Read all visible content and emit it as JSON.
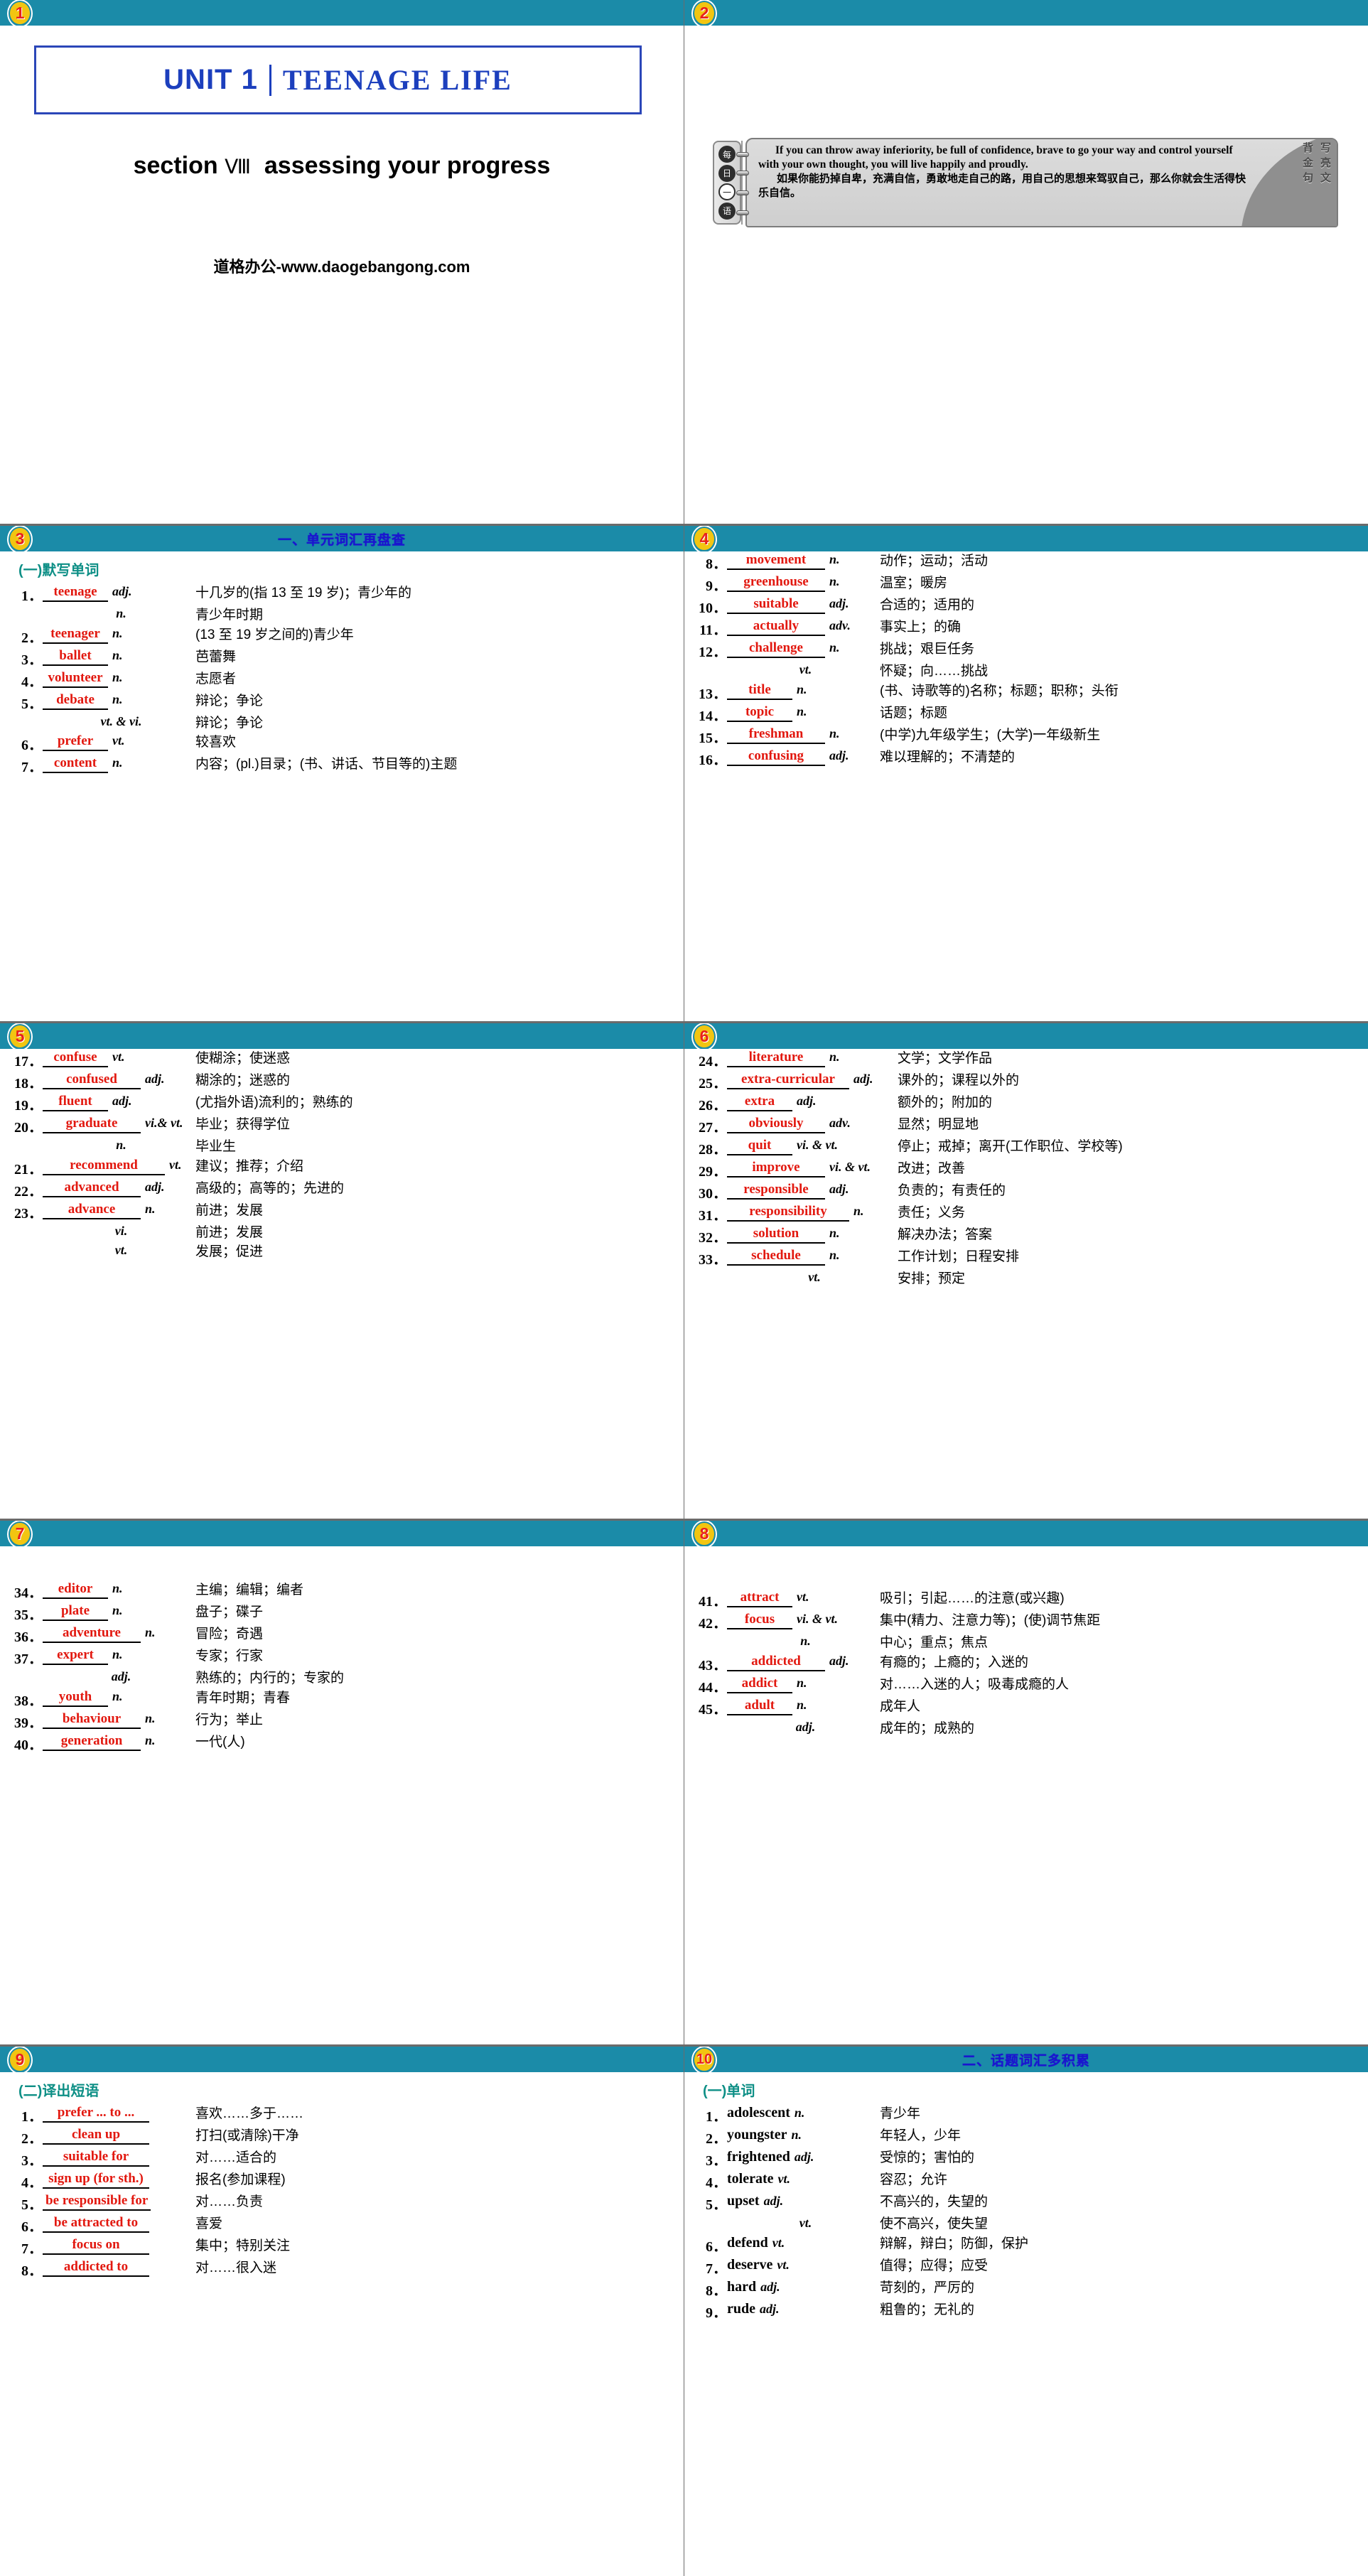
{
  "slides": [
    {
      "badge": "1",
      "title": "",
      "unit_label": "UNIT 1",
      "unit_name": "TEENAGE LIFE",
      "section_label": "section",
      "section_numeral": "Ⅷ",
      "section_name": "assessing your progress",
      "footer": "道格办公-www.daogebangong.com"
    },
    {
      "badge": "2",
      "title": "",
      "left_tab": [
        "每",
        "日",
        "一",
        "语"
      ],
      "quote_en": "If you can throw away inferiority, be full of confidence, brave to go your way and control yourself with your own thought, you will live happily and proudly.",
      "quote_zh": "如果你能扔掉自卑，充满自信，勇敢地走自己的路，用自己的思想来驾驭自己，那么你就会生活得快乐自信。",
      "right_tab_col1": "写亮文",
      "right_tab_col2": "背金句"
    },
    {
      "badge": "3",
      "title": "一、单元词汇再盘查",
      "subhead": "(一)默写单词",
      "rows": [
        {
          "num": "1．",
          "word": "teenage",
          "pos": "adj.",
          "def": "十几岁的(指 13 至 19 岁)；青少年的"
        },
        {
          "num": "",
          "word": "",
          "pos": "n.",
          "def": "青少年时期"
        },
        {
          "num": "2．",
          "word": "teenager",
          "pos": "n.",
          "def": "(13 至 19 岁之间的)青少年"
        },
        {
          "num": "3．",
          "word": "ballet",
          "pos": "n.",
          "def": "芭蕾舞"
        },
        {
          "num": "4．",
          "word": "volunteer",
          "pos": "n.",
          "def": "志愿者"
        },
        {
          "num": "5．",
          "word": "debate",
          "pos": "n.",
          "def": "辩论；争论"
        },
        {
          "num": "",
          "word": "",
          "pos": "vt. & vi.",
          "def": "辩论；争论"
        },
        {
          "num": "6．",
          "word": "prefer",
          "pos": "vt.",
          "def": "较喜欢"
        },
        {
          "num": "7．",
          "word": "content",
          "pos": "n.",
          "def": "内容；(pl.)目录；(书、讲话、节目等的)主题"
        }
      ]
    },
    {
      "badge": "4",
      "title": "",
      "rows": [
        {
          "num": "8．",
          "word": "movement",
          "pos": "n.",
          "def": "动作；运动；活动"
        },
        {
          "num": "9．",
          "word": "greenhouse",
          "pos": "n.",
          "def": "温室；暖房"
        },
        {
          "num": "10．",
          "word": "suitable",
          "pos": "adj.",
          "def": "合适的；适用的"
        },
        {
          "num": "11．",
          "word": "actually",
          "pos": "adv.",
          "def": "事实上；的确"
        },
        {
          "num": "12．",
          "word": "challenge",
          "pos": "n.",
          "def": "挑战；艰巨任务"
        },
        {
          "num": "",
          "word": "",
          "pos": "vt.",
          "def": "怀疑；向……挑战"
        },
        {
          "num": "13．",
          "word": "title",
          "pos": "n.",
          "def": "(书、诗歌等的)名称；标题；职称；头衔"
        },
        {
          "num": "14．",
          "word": "topic",
          "pos": "n.",
          "def": "话题；标题"
        },
        {
          "num": "15．",
          "word": "freshman",
          "pos": "n.",
          "def": "(中学)九年级学生；(大学)一年级新生"
        },
        {
          "num": "16．",
          "word": "confusing",
          "pos": "adj.",
          "def": "难以理解的；不清楚的"
        }
      ]
    },
    {
      "badge": "5",
      "title": "",
      "rows": [
        {
          "num": "17．",
          "word": "confuse",
          "pos": "vt.",
          "def": "使糊涂；使迷惑"
        },
        {
          "num": "18．",
          "word": "confused",
          "pos": "adj.",
          "def": "糊涂的；迷惑的"
        },
        {
          "num": "19．",
          "word": "fluent",
          "pos": "adj.",
          "def": "(尤指外语)流利的；熟练的"
        },
        {
          "num": "20．",
          "word": "graduate",
          "pos": "vi.& vt.",
          "def": "毕业；获得学位"
        },
        {
          "num": "",
          "word": "",
          "pos": "n.",
          "def": "毕业生"
        },
        {
          "num": "21．",
          "word": "recommend",
          "pos": "vt.",
          "def": "建议；推荐；介绍"
        },
        {
          "num": "22．",
          "word": "advanced",
          "pos": "adj.",
          "def": "高级的；高等的；先进的"
        },
        {
          "num": "23．",
          "word": "advance",
          "pos": "n.",
          "def": "前进；发展"
        },
        {
          "num": "",
          "word": "",
          "pos": "vi.",
          "def": "前进；发展"
        },
        {
          "num": "",
          "word": "",
          "pos": "vt.",
          "def": "发展；促进"
        }
      ]
    },
    {
      "badge": "6",
      "title": "",
      "rows": [
        {
          "num": "24．",
          "word": "literature",
          "pos": "n.",
          "def": "文学；文学作品"
        },
        {
          "num": "25．",
          "word": "extra-curricular",
          "pos": "adj.",
          "def": "课外的；课程以外的"
        },
        {
          "num": "26．",
          "word": "extra",
          "pos": "adj.",
          "def": "额外的；附加的"
        },
        {
          "num": "27．",
          "word": "obviously",
          "pos": "adv.",
          "def": "显然；明显地"
        },
        {
          "num": "28．",
          "word": "quit",
          "pos": "vi. & vt.",
          "def": "停止；戒掉；离开(工作职位、学校等)"
        },
        {
          "num": "29．",
          "word": "improve",
          "pos": "vi. & vt.",
          "def": "改进；改善"
        },
        {
          "num": "30．",
          "word": "responsible",
          "pos": "adj.",
          "def": "负责的；有责任的"
        },
        {
          "num": "31．",
          "word": "responsibility",
          "pos": "n.",
          "def": "责任；义务"
        },
        {
          "num": "32．",
          "word": "solution",
          "pos": "n.",
          "def": "解决办法；答案"
        },
        {
          "num": "33．",
          "word": "schedule",
          "pos": "n.",
          "def": "工作计划；日程安排"
        },
        {
          "num": "",
          "word": "",
          "pos": "vt.",
          "def": "安排；预定"
        }
      ]
    },
    {
      "badge": "7",
      "title": "",
      "rows": [
        {
          "num": "34．",
          "word": "editor",
          "pos": "n.",
          "def": "主编；编辑；编者"
        },
        {
          "num": "35．",
          "word": "plate",
          "pos": "n.",
          "def": "盘子；碟子"
        },
        {
          "num": "36．",
          "word": "adventure",
          "pos": "n.",
          "def": "冒险；奇遇"
        },
        {
          "num": "37．",
          "word": "expert",
          "pos": "n.",
          "def": "专家；行家"
        },
        {
          "num": "",
          "word": "",
          "pos": "adj.",
          "def": "熟练的；内行的；专家的"
        },
        {
          "num": "38．",
          "word": "youth",
          "pos": "n.",
          "def": "青年时期；青春"
        },
        {
          "num": "39．",
          "word": "behaviour",
          "pos": "n.",
          "def": "行为；举止"
        },
        {
          "num": "40．",
          "word": "generation",
          "pos": "n.",
          "def": "一代(人)"
        }
      ]
    },
    {
      "badge": "8",
      "title": "",
      "rows": [
        {
          "num": "41．",
          "word": "attract",
          "pos": "vt.",
          "def": "吸引；引起……的注意(或兴趣)"
        },
        {
          "num": "42．",
          "word": "focus",
          "pos": "vi. & vt.",
          "def": "集中(精力、注意力等)；(使)调节焦距"
        },
        {
          "num": "",
          "word": "",
          "pos": "n.",
          "def": "中心；重点；焦点"
        },
        {
          "num": "43．",
          "word": "addicted",
          "pos": "adj.",
          "def": "有瘾的；上瘾的；入迷的"
        },
        {
          "num": "44．",
          "word": "addict",
          "pos": "n.",
          "def": "对……入迷的人；吸毒成瘾的人"
        },
        {
          "num": "45．",
          "word": "adult",
          "pos": "n.",
          "def": "成年人"
        },
        {
          "num": "",
          "word": "",
          "pos": "adj.",
          "def": "成年的；成熟的"
        }
      ]
    },
    {
      "badge": "9",
      "title": "",
      "subhead": "(二)译出短语",
      "rows": [
        {
          "num": "1．",
          "word": "prefer ... to ...",
          "pos": "",
          "def": "喜欢……多于……"
        },
        {
          "num": "2．",
          "word": "clean up",
          "pos": "",
          "def": "打扫(或清除)干净"
        },
        {
          "num": "3．",
          "word": "suitable for",
          "pos": "",
          "def": "对……适合的"
        },
        {
          "num": "4．",
          "word": "sign up (for sth.)",
          "pos": "",
          "def": "报名(参加课程)"
        },
        {
          "num": "5．",
          "word": "be responsible for",
          "pos": "",
          "def": "对……负责"
        },
        {
          "num": "6．",
          "word": "be attracted to",
          "pos": "",
          "def": "喜爱"
        },
        {
          "num": "7．",
          "word": "focus on",
          "pos": "",
          "def": "集中；特别关注"
        },
        {
          "num": "8．",
          "word": "addicted to",
          "pos": "",
          "def": "对……很入迷"
        }
      ]
    },
    {
      "badge": "10",
      "title": "二、话题词汇多积累",
      "subhead": "(一)单词",
      "rows": [
        {
          "num": "1．",
          "word": "adolescent",
          "pos": "n.",
          "def": "青少年"
        },
        {
          "num": "2．",
          "word": "youngster",
          "pos": "n.",
          "def": "年轻人，少年"
        },
        {
          "num": "3．",
          "word": "frightened",
          "pos": "adj.",
          "def": "受惊的；害怕的"
        },
        {
          "num": "4．",
          "word": "tolerate",
          "pos": "vt.",
          "def": "容忍；允许"
        },
        {
          "num": "5．",
          "word": "upset",
          "pos": "adj.",
          "def": "不高兴的，失望的"
        },
        {
          "num": "",
          "word": "",
          "pos": "vt.",
          "def": "使不高兴，使失望"
        },
        {
          "num": "6．",
          "word": "defend",
          "pos": "vt.",
          "def": "辩解，辩白；防御，保护"
        },
        {
          "num": "7．",
          "word": "deserve",
          "pos": "vt.",
          "def": "值得；应得；应受"
        },
        {
          "num": "8．",
          "word": "hard",
          "pos": "adj.",
          "def": "苛刻的，严厉的"
        },
        {
          "num": "9．",
          "word": "rude",
          "pos": "adj.",
          "def": "粗鲁的；无礼的"
        }
      ]
    }
  ],
  "colors": {
    "band": "#1b8ba8",
    "band_title": "#1a15cf",
    "word_red": "#e2180f",
    "subhead_teal": "#0e8f86",
    "title_blue": "#1c3fbd",
    "divider_gray": "#6b6b6b"
  }
}
